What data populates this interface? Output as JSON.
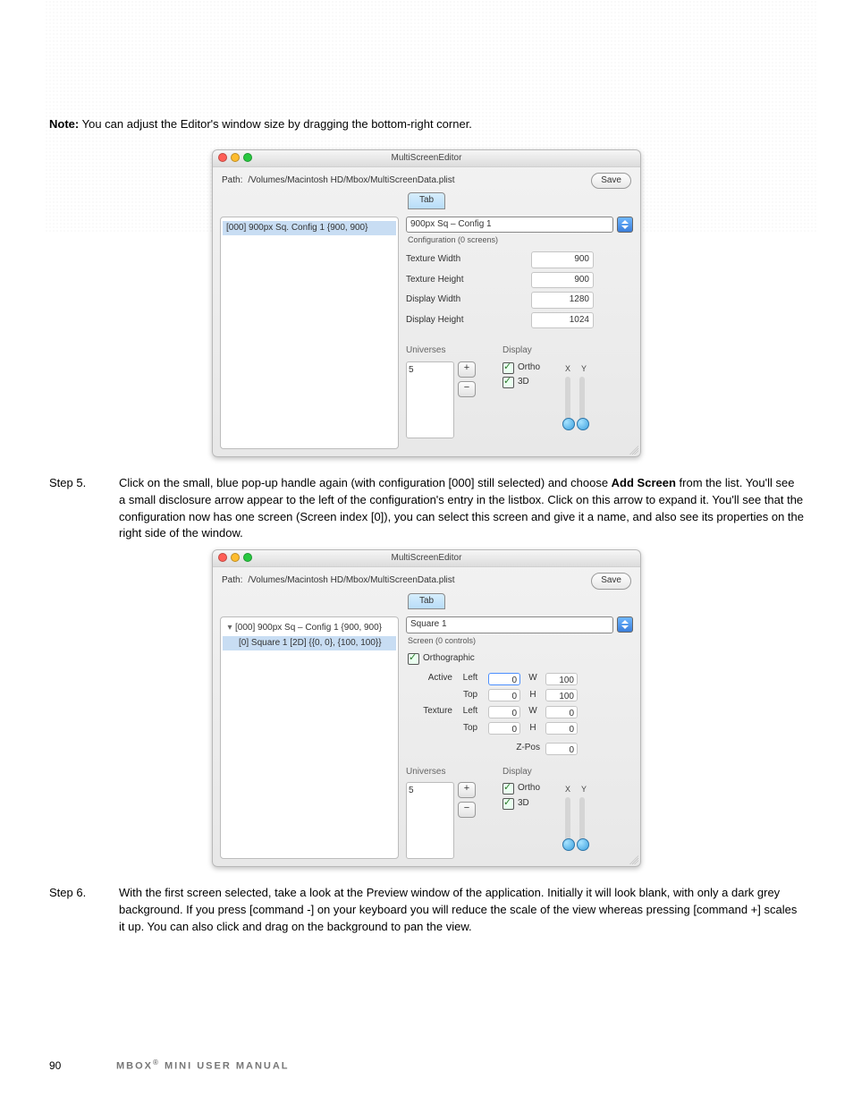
{
  "note_label": "Note:",
  "note_text": "You can adjust the Editor's window size by dragging the bottom-right corner.",
  "win1": {
    "title": "MultiScreenEditor",
    "path_label": "Path:",
    "path": "/Volumes/Macintosh HD/Mbox/MultiScreenData.plist",
    "save": "Save",
    "tab": "Tab",
    "list_item": "[000] 900px Sq. Config 1 {900, 900}",
    "name": "900px Sq – Config 1",
    "subtitle": "Configuration (0 screens)",
    "props": {
      "tw_l": "Texture Width",
      "tw_v": "900",
      "th_l": "Texture Height",
      "th_v": "900",
      "dw_l": "Display Width",
      "dw_v": "1280",
      "dh_l": "Display Height",
      "dh_v": "1024"
    },
    "universes_hdr": "Universes",
    "uni_value": "5",
    "display_hdr": "Display",
    "ortho": "Ortho",
    "threeD": "3D",
    "x": "X",
    "y": "Y"
  },
  "step5_label": "Step    5.",
  "step5_text_a": "Click on the small, blue pop-up handle again (with configuration [000] still selected) and choose ",
  "step5_bold": "Add Screen",
  "step5_text_b": " from the list. You'll see a small disclosure arrow appear to the left of the configuration's entry in the listbox. Click on this arrow to expand it. You'll see that the configuration now has one screen (Screen index [0]), you can select this screen and give it a name, and also see its properties on the right side of the window.",
  "win2": {
    "title": "MultiScreenEditor",
    "path_label": "Path:",
    "path": "/Volumes/Macintosh HD/Mbox/MultiScreenData.plist",
    "save": "Save",
    "tab": "Tab",
    "list_parent": "[000] 900px Sq – Config 1 {900, 900}",
    "list_child": "[0] Square 1  [2D] {{0, 0}, {100, 100}}",
    "name": "Square 1",
    "subtitle": "Screen (0 controls)",
    "orthographic": "Orthographic",
    "grid": {
      "active": "Active",
      "texture": "Texture",
      "left": "Left",
      "top": "Top",
      "w": "W",
      "h": "H",
      "zpos": "Z-Pos",
      "a_left": "0",
      "a_top": "0",
      "a_w": "100",
      "a_h": "100",
      "t_left": "0",
      "t_top": "0",
      "t_w": "0",
      "t_h": "0",
      "z": "0"
    },
    "universes_hdr": "Universes",
    "uni_value": "5",
    "display_hdr": "Display",
    "ortho": "Ortho",
    "threeD": "3D",
    "x": "X",
    "y": "Y"
  },
  "step6_label": "Step    6.",
  "step6_text": "With the first screen selected, take a look at the Preview window of the application. Initially it will look blank, with only a dark grey background. If you press [command -] on your keyboard you will reduce the scale of the view whereas pressing [command +] scales it up. You can also click and drag on the background to pan the view.",
  "footer_page": "90",
  "footer_title_a": "MBOX",
  "footer_title_b": " MINI USER MANUAL"
}
